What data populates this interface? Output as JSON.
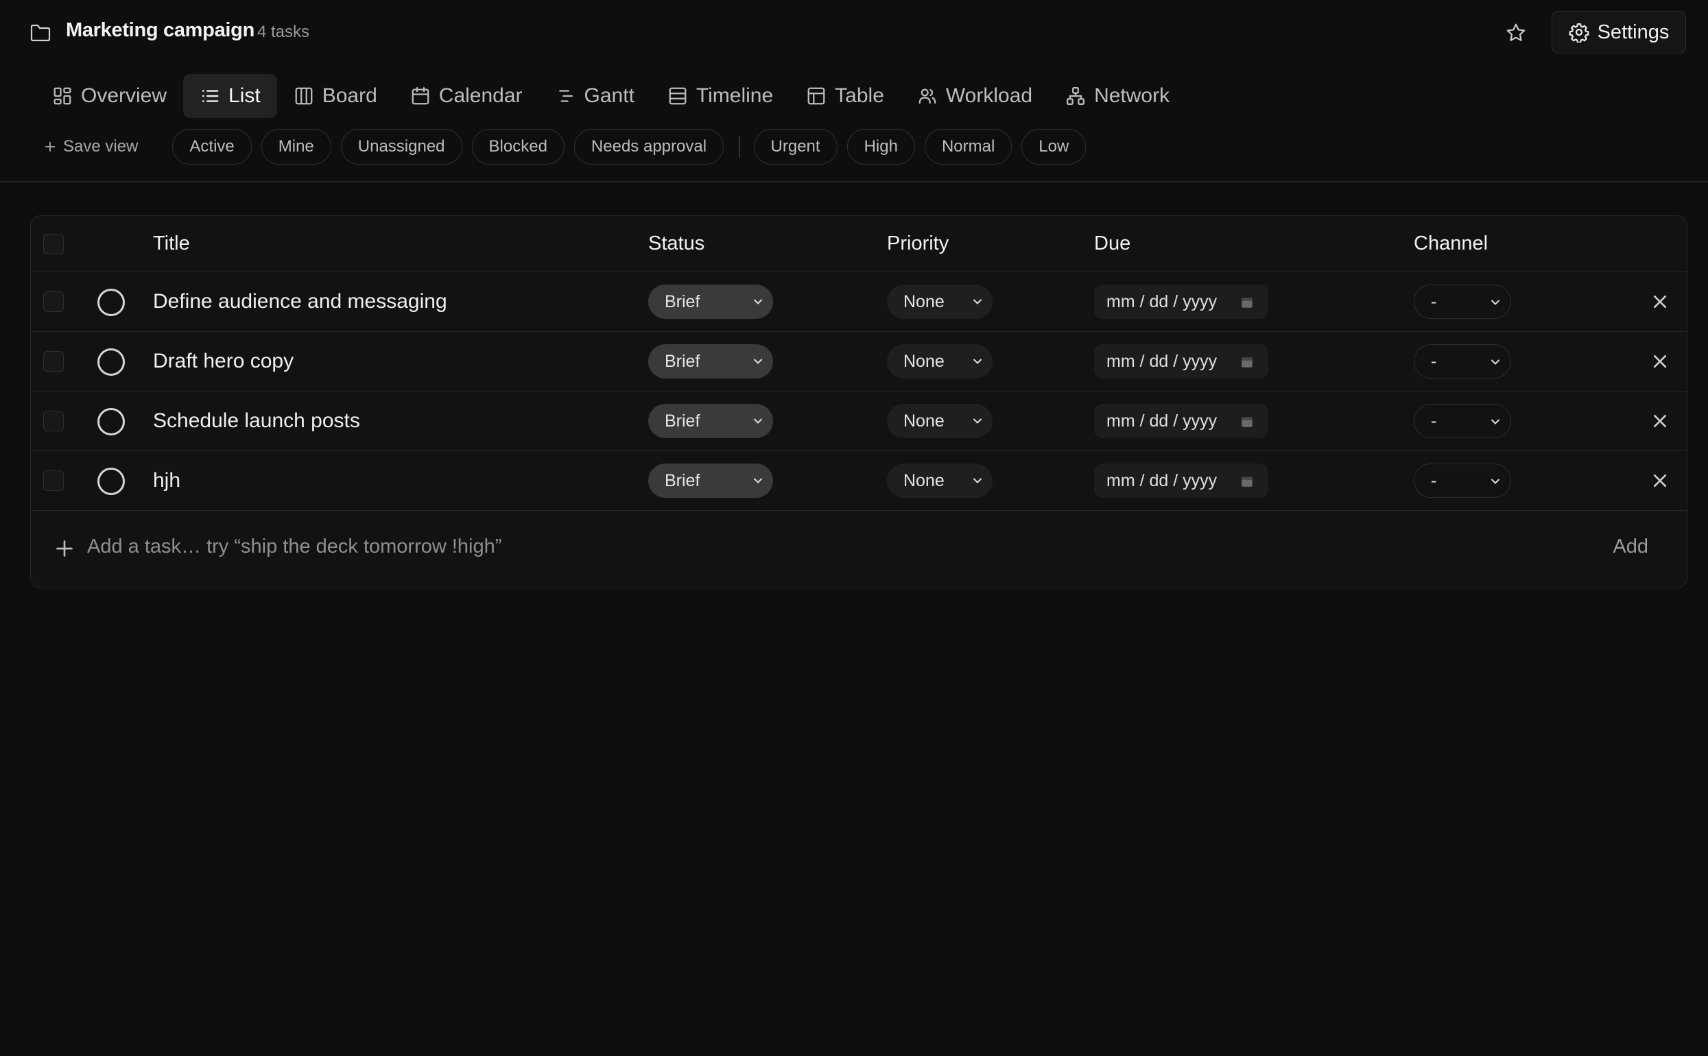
{
  "header": {
    "project_title": "Marketing campaign",
    "task_count": "4 tasks",
    "settings_label": "Settings",
    "star_icon": "star-icon"
  },
  "tabs": [
    {
      "label": "Overview",
      "icon": "overview-icon",
      "active": false
    },
    {
      "label": "List",
      "icon": "list-icon",
      "active": true
    },
    {
      "label": "Board",
      "icon": "board-icon",
      "active": false
    },
    {
      "label": "Calendar",
      "icon": "calendar-icon",
      "active": false
    },
    {
      "label": "Gantt",
      "icon": "gantt-icon",
      "active": false
    },
    {
      "label": "Timeline",
      "icon": "timeline-icon",
      "active": false
    },
    {
      "label": "Table",
      "icon": "table-icon",
      "active": false
    },
    {
      "label": "Workload",
      "icon": "workload-icon",
      "active": false
    },
    {
      "label": "Network",
      "icon": "network-icon",
      "active": false
    }
  ],
  "filters": {
    "save_view": "Save view",
    "status_chips": [
      "Active",
      "Mine",
      "Unassigned",
      "Blocked",
      "Needs approval"
    ],
    "priority_chips": [
      "Urgent",
      "High",
      "Normal",
      "Low"
    ]
  },
  "table": {
    "columns": {
      "title": "Title",
      "status": "Status",
      "priority": "Priority",
      "due": "Due",
      "channel": "Channel"
    },
    "rows": [
      {
        "title": "Define audience and messaging",
        "status": "Brief",
        "priority": "None",
        "due": "mm / dd / yyyy",
        "channel": "-"
      },
      {
        "title": "Draft hero copy",
        "status": "Brief",
        "priority": "None",
        "due": "mm / dd / yyyy",
        "channel": "-"
      },
      {
        "title": "Schedule launch posts",
        "status": "Brief",
        "priority": "None",
        "due": "mm / dd / yyyy",
        "channel": "-"
      },
      {
        "title": "hjh",
        "status": "Brief",
        "priority": "None",
        "due": "mm / dd / yyyy",
        "channel": "-"
      }
    ],
    "add_placeholder": "Add a task… try “ship the deck tomorrow !high”",
    "add_label": "Add"
  },
  "colors": {
    "background": "#0e0e0e",
    "status_pill": "#3a3a3a",
    "text": "#ececec"
  }
}
